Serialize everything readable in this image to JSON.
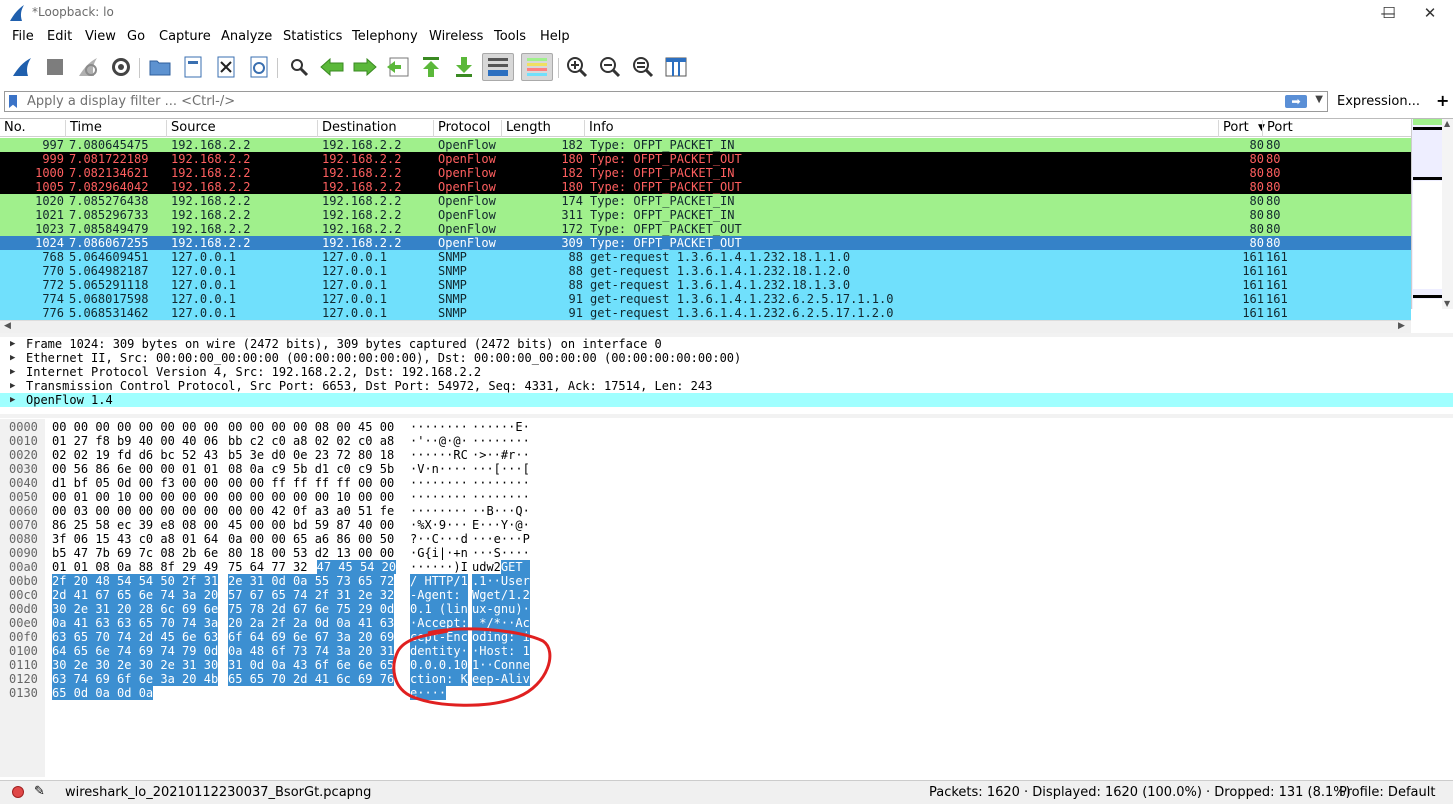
{
  "window": {
    "title": "*Loopback: lo",
    "minimize": "—",
    "maximize": "☐",
    "close": "✕"
  },
  "menu": [
    "File",
    "Edit",
    "View",
    "Go",
    "Capture",
    "Analyze",
    "Statistics",
    "Telephony",
    "Wireless",
    "Tools",
    "Help"
  ],
  "filter": {
    "placeholder": "Apply a display filter ... <Ctrl-/>",
    "expression_label": "Expression...",
    "add": "+"
  },
  "packet_list": {
    "columns": [
      "No.",
      "Time",
      "Source",
      "Destination",
      "Protocol",
      "Length",
      "Info",
      "Port",
      "Port"
    ],
    "rows": [
      {
        "no": "997",
        "time": "7.080645475",
        "src": "192.168.2.2",
        "dst": "192.168.2.2",
        "proto": "OpenFlow",
        "len": "182",
        "info": "Type: OFPT_PACKET_IN",
        "sport": "80",
        "dport": "80",
        "bg": "#a0f08c",
        "fg": "#12272e"
      },
      {
        "no": "999",
        "time": "7.081722189",
        "src": "192.168.2.2",
        "dst": "192.168.2.2",
        "proto": "OpenFlow",
        "len": "180",
        "info": "Type: OFPT_PACKET_OUT",
        "sport": "80",
        "dport": "80",
        "bg": "#000000",
        "fg": "#ff5f5f"
      },
      {
        "no": "1000",
        "time": "7.082134621",
        "src": "192.168.2.2",
        "dst": "192.168.2.2",
        "proto": "OpenFlow",
        "len": "182",
        "info": "Type: OFPT_PACKET_IN",
        "sport": "80",
        "dport": "80",
        "bg": "#000000",
        "fg": "#ff5f5f"
      },
      {
        "no": "1005",
        "time": "7.082964042",
        "src": "192.168.2.2",
        "dst": "192.168.2.2",
        "proto": "OpenFlow",
        "len": "180",
        "info": "Type: OFPT_PACKET_OUT",
        "sport": "80",
        "dport": "80",
        "bg": "#000000",
        "fg": "#ff5f5f"
      },
      {
        "no": "1020",
        "time": "7.085276438",
        "src": "192.168.2.2",
        "dst": "192.168.2.2",
        "proto": "OpenFlow",
        "len": "174",
        "info": "Type: OFPT_PACKET_IN",
        "sport": "80",
        "dport": "80",
        "bg": "#a0f08c",
        "fg": "#12272e"
      },
      {
        "no": "1021",
        "time": "7.085296733",
        "src": "192.168.2.2",
        "dst": "192.168.2.2",
        "proto": "OpenFlow",
        "len": "311",
        "info": "Type: OFPT_PACKET_IN",
        "sport": "80",
        "dport": "80",
        "bg": "#a0f08c",
        "fg": "#12272e"
      },
      {
        "no": "1023",
        "time": "7.085849479",
        "src": "192.168.2.2",
        "dst": "192.168.2.2",
        "proto": "OpenFlow",
        "len": "172",
        "info": "Type: OFPT_PACKET_OUT",
        "sport": "80",
        "dport": "80",
        "bg": "#a0f08c",
        "fg": "#12272e"
      },
      {
        "no": "1024",
        "time": "7.086067255",
        "src": "192.168.2.2",
        "dst": "192.168.2.2",
        "proto": "OpenFlow",
        "len": "309",
        "info": "Type: OFPT_PACKET_OUT",
        "sport": "80",
        "dport": "80",
        "bg": "#3582c8",
        "fg": "#ffffff"
      },
      {
        "no": "768",
        "time": "5.064609451",
        "src": "127.0.0.1",
        "dst": "127.0.0.1",
        "proto": "SNMP",
        "len": "88",
        "info": "get-request 1.3.6.1.4.1.232.18.1.1.0",
        "sport": "161",
        "dport": "161",
        "bg": "#70e0fc",
        "fg": "#12272e"
      },
      {
        "no": "770",
        "time": "5.064982187",
        "src": "127.0.0.1",
        "dst": "127.0.0.1",
        "proto": "SNMP",
        "len": "88",
        "info": "get-request 1.3.6.1.4.1.232.18.1.2.0",
        "sport": "161",
        "dport": "161",
        "bg": "#70e0fc",
        "fg": "#12272e"
      },
      {
        "no": "772",
        "time": "5.065291118",
        "src": "127.0.0.1",
        "dst": "127.0.0.1",
        "proto": "SNMP",
        "len": "88",
        "info": "get-request 1.3.6.1.4.1.232.18.1.3.0",
        "sport": "161",
        "dport": "161",
        "bg": "#70e0fc",
        "fg": "#12272e"
      },
      {
        "no": "774",
        "time": "5.068017598",
        "src": "127.0.0.1",
        "dst": "127.0.0.1",
        "proto": "SNMP",
        "len": "91",
        "info": "get-request 1.3.6.1.4.1.232.6.2.5.17.1.1.0",
        "sport": "161",
        "dport": "161",
        "bg": "#70e0fc",
        "fg": "#12272e"
      },
      {
        "no": "776",
        "time": "5.068531462",
        "src": "127.0.0.1",
        "dst": "127.0.0.1",
        "proto": "SNMP",
        "len": "91",
        "info": "get-request 1.3.6.1.4.1.232.6.2.5.17.1.2.0",
        "sport": "161",
        "dport": "161",
        "bg": "#70e0fc",
        "fg": "#12272e"
      }
    ]
  },
  "details": [
    "Frame 1024: 309 bytes on wire (2472 bits), 309 bytes captured (2472 bits) on interface 0",
    "Ethernet II, Src: 00:00:00_00:00:00 (00:00:00:00:00:00), Dst: 00:00:00_00:00:00 (00:00:00:00:00:00)",
    "Internet Protocol Version 4, Src: 192.168.2.2, Dst: 192.168.2.2",
    "Transmission Control Protocol, Src Port: 6653, Dst Port: 54972, Seq: 4331, Ack: 17514, Len: 243",
    "OpenFlow 1.4"
  ],
  "details_highlight_color": "#a0ffff",
  "bytes": [
    {
      "off": "0000",
      "h1": "00 00 00 00 00 00 00 00",
      "h2": "00 00 00 00 08 00 45 00",
      "a1": "········",
      "a2": "······E·"
    },
    {
      "off": "0010",
      "h1": "01 27 f8 b9 40 00 40 06",
      "h2": "bb c2 c0 a8 02 02 c0 a8",
      "a1": "·'··@·@·",
      "a2": "········"
    },
    {
      "off": "0020",
      "h1": "02 02 19 fd d6 bc 52 43",
      "h2": "b5 3e d0 0e 23 72 80 18",
      "a1": "······RC",
      "a2": "·>··#r··"
    },
    {
      "off": "0030",
      "h1": "00 56 86 6e 00 00 01 01",
      "h2": "08 0a c9 5b d1 c0 c9 5b",
      "a1": "·V·n····",
      "a2": "···[···["
    },
    {
      "off": "0040",
      "h1": "d1 bf 05 0d 00 f3 00 00",
      "h2": "00 00 ff ff ff ff 00 00",
      "a1": "········",
      "a2": "········"
    },
    {
      "off": "0050",
      "h1": "00 01 00 10 00 00 00 00",
      "h2": "00 00 00 00 00 10 00 00",
      "a1": "········",
      "a2": "········"
    },
    {
      "off": "0060",
      "h1": "00 03 00 00 00 00 00 00",
      "h2": "00 00 42 0f a3 a0 51 fe",
      "a1": "········",
      "a2": "··B···Q·"
    },
    {
      "off": "0070",
      "h1": "86 25 58 ec 39 e8 08 00",
      "h2": "45 00 00 bd 59 87 40 00",
      "a1": "·%X·9···",
      "a2": "E···Y·@·"
    },
    {
      "off": "0080",
      "h1": "3f 06 15 43 c0 a8 01 64",
      "h2": "0a 00 00 65 a6 86 00 50",
      "a1": "?··C···d",
      "a2": "···e···P"
    },
    {
      "off": "0090",
      "h1": "b5 47 7b 69 7c 08 2b 6e",
      "h2": "80 18 00 53 d2 13 00 00",
      "a1": "·G{i|·+n",
      "a2": "···S····"
    },
    {
      "off": "00a0",
      "h1": "01 01 08 0a 88 8f 29 49",
      "h2": "75 64 77 32",
      "h2b": "47 45 54 20",
      "a1": "······)I",
      "a2": "udw2",
      "a2b": "GET "
    },
    {
      "off": "00b0",
      "h1b": "2f 20 48 54 54 50 2f 31",
      "h2b": "2e 31 0d 0a 55 73 65 72",
      "a1b": "/ HTTP/1",
      "a2b": ".1··User"
    },
    {
      "off": "00c0",
      "h1b": "2d 41 67 65 6e 74 3a 20",
      "h2b": "57 67 65 74 2f 31 2e 32",
      "a1b": "-Agent: ",
      "a2b": "Wget/1.2"
    },
    {
      "off": "00d0",
      "h1b": "30 2e 31 20 28 6c 69 6e",
      "h2b": "75 78 2d 67 6e 75 29 0d",
      "a1b": "0.1 (lin",
      "a2b": "ux-gnu)·"
    },
    {
      "off": "00e0",
      "h1b": "0a 41 63 63 65 70 74 3a",
      "h2b": "20 2a 2f 2a 0d 0a 41 63",
      "a1b": "·Accept:",
      "a2b": " */*··Ac"
    },
    {
      "off": "00f0",
      "h1b": "63 65 70 74 2d 45 6e 63",
      "h2b": "6f 64 69 6e 67 3a 20 69",
      "a1b": "cept-Enc",
      "a2b": "oding: i"
    },
    {
      "off": "0100",
      "h1b": "64 65 6e 74 69 74 79 0d",
      "h2b": "0a 48 6f 73 74 3a 20 31",
      "a1b": "dentity·",
      "a2b": "·Host: 1"
    },
    {
      "off": "0110",
      "h1b": "30 2e 30 2e 30 2e 31 30",
      "h2b": "31 0d 0a 43 6f 6e 6e 65",
      "a1b": "0.0.0.10",
      "a2b": "1··Conne"
    },
    {
      "off": "0120",
      "h1b": "63 74 69 6f 6e 3a 20 4b",
      "h2b": "65 65 70 2d 41 6c 69 76",
      "a1b": "ction: K",
      "a2b": "eep-Aliv"
    },
    {
      "off": "0130",
      "h1b": "65 0d 0a 0d 0a",
      "a1b": "e····"
    }
  ],
  "status": {
    "file": "wireshark_lo_20210112230037_BsorGt.pcapng",
    "packets": "Packets: 1620 · Displayed: 1620 (100.0%) · Dropped: 131 (8.1%)",
    "profile": "Profile: Default"
  },
  "annotation_color": "#e02020"
}
